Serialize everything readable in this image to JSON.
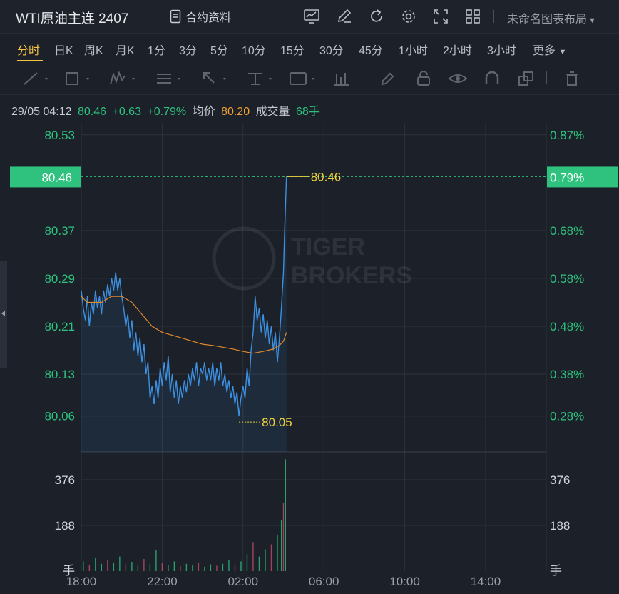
{
  "header": {
    "title": "WTI原油主连 2407",
    "info_label": "合约资料",
    "layout_label": "未命名图表布局",
    "icons": [
      "chart-indicator-icon",
      "edit-icon",
      "refresh-icon",
      "settings-icon",
      "fullscreen-icon",
      "grid-layout-icon"
    ]
  },
  "tabs": [
    "分时",
    "日K",
    "周K",
    "月K",
    "1分",
    "3分",
    "5分",
    "10分",
    "15分",
    "30分",
    "45分",
    "1小时",
    "2小时",
    "3小时",
    "更多"
  ],
  "active_tab": "分时",
  "infoline": {
    "datetime": "29/05 04:12",
    "price": "80.46",
    "change": "+0.63",
    "change_pct": "+0.79%",
    "avg_label": "均价",
    "avg_value": "80.20",
    "volume_label": "成交量",
    "volume_value": "68手"
  },
  "colors": {
    "up": "#2ec27e",
    "price_line": "#3d8fe0",
    "avg_line": "#e08a2a",
    "label_yellow": "#f0d23c",
    "background": "#1b2029",
    "grid": "#2c323c"
  },
  "chart_data": {
    "type": "line",
    "price_axis_labels": [
      "80.53",
      "80.46",
      "80.37",
      "80.29",
      "80.21",
      "80.13",
      "80.06"
    ],
    "pct_axis_labels": [
      "0.87%",
      "0.79%",
      "0.68%",
      "0.58%",
      "0.48%",
      "0.38%",
      "0.28%"
    ],
    "current_price_tag": "80.46",
    "current_pct_tag": "0.79%",
    "high_label": "80.46",
    "low_label": "80.05",
    "x_tick_labels": [
      "18:00",
      "22:00",
      "02:00",
      "06:00",
      "10:00",
      "14:00"
    ],
    "x_range_hours": [
      0,
      23
    ],
    "ylim": [
      80.0,
      80.55
    ],
    "volume_axis_labels": [
      "376",
      "188",
      "手"
    ],
    "volume_ylim": [
      0,
      470
    ],
    "watermark": "TIGER BROKERS",
    "price_series": [
      [
        0.0,
        80.27
      ],
      [
        0.1,
        80.24
      ],
      [
        0.2,
        80.22
      ],
      [
        0.3,
        80.26
      ],
      [
        0.4,
        80.21
      ],
      [
        0.5,
        80.25
      ],
      [
        0.6,
        80.23
      ],
      [
        0.7,
        80.27
      ],
      [
        0.8,
        80.24
      ],
      [
        0.9,
        80.26
      ],
      [
        1.0,
        80.23
      ],
      [
        1.1,
        80.27
      ],
      [
        1.2,
        80.25
      ],
      [
        1.3,
        80.28
      ],
      [
        1.4,
        80.26
      ],
      [
        1.5,
        80.29
      ],
      [
        1.6,
        80.27
      ],
      [
        1.7,
        80.3
      ],
      [
        1.8,
        80.27
      ],
      [
        1.9,
        80.29
      ],
      [
        2.0,
        80.26
      ],
      [
        2.1,
        80.24
      ],
      [
        2.2,
        80.21
      ],
      [
        2.3,
        80.23
      ],
      [
        2.4,
        80.19
      ],
      [
        2.5,
        80.22
      ],
      [
        2.6,
        80.17
      ],
      [
        2.7,
        80.2
      ],
      [
        2.8,
        80.16
      ],
      [
        2.9,
        80.19
      ],
      [
        3.0,
        80.15
      ],
      [
        3.1,
        80.18
      ],
      [
        3.2,
        80.13
      ],
      [
        3.3,
        80.15
      ],
      [
        3.4,
        80.09
      ],
      [
        3.5,
        80.11
      ],
      [
        3.6,
        80.08
      ],
      [
        3.7,
        80.12
      ],
      [
        3.8,
        80.09
      ],
      [
        3.9,
        80.14
      ],
      [
        4.0,
        80.11
      ],
      [
        4.1,
        80.15
      ],
      [
        4.2,
        80.12
      ],
      [
        4.3,
        80.16
      ],
      [
        4.4,
        80.1
      ],
      [
        4.5,
        80.13
      ],
      [
        4.6,
        80.09
      ],
      [
        4.7,
        80.12
      ],
      [
        4.8,
        80.08
      ],
      [
        4.9,
        80.11
      ],
      [
        5.0,
        80.09
      ],
      [
        5.1,
        80.12
      ],
      [
        5.2,
        80.1
      ],
      [
        5.3,
        80.13
      ],
      [
        5.4,
        80.11
      ],
      [
        5.5,
        80.14
      ],
      [
        5.6,
        80.12
      ],
      [
        5.7,
        80.15
      ],
      [
        5.8,
        80.11
      ],
      [
        5.9,
        80.14
      ],
      [
        6.0,
        80.13
      ],
      [
        6.1,
        80.15
      ],
      [
        6.2,
        80.12
      ],
      [
        6.3,
        80.14
      ],
      [
        6.4,
        80.12
      ],
      [
        6.5,
        80.15
      ],
      [
        6.6,
        80.11
      ],
      [
        6.7,
        80.14
      ],
      [
        6.8,
        80.12
      ],
      [
        6.9,
        80.15
      ],
      [
        7.0,
        80.11
      ],
      [
        7.1,
        80.13
      ],
      [
        7.2,
        80.1
      ],
      [
        7.3,
        80.12
      ],
      [
        7.4,
        80.09
      ],
      [
        7.5,
        80.11
      ],
      [
        7.6,
        80.08
      ],
      [
        7.7,
        80.1
      ],
      [
        7.8,
        80.06
      ],
      [
        7.9,
        80.09
      ],
      [
        8.0,
        80.11
      ],
      [
        8.1,
        80.09
      ],
      [
        8.2,
        80.14
      ],
      [
        8.3,
        80.11
      ],
      [
        8.4,
        80.17
      ],
      [
        8.5,
        80.2
      ],
      [
        8.6,
        80.26
      ],
      [
        8.7,
        80.22
      ],
      [
        8.8,
        80.24
      ],
      [
        8.9,
        80.2
      ],
      [
        9.0,
        80.23
      ],
      [
        9.1,
        80.19
      ],
      [
        9.2,
        80.22
      ],
      [
        9.3,
        80.18
      ],
      [
        9.4,
        80.21
      ],
      [
        9.5,
        80.17
      ],
      [
        9.6,
        80.2
      ],
      [
        9.7,
        80.15
      ],
      [
        9.8,
        80.19
      ],
      [
        9.9,
        80.24
      ],
      [
        10.0,
        80.3
      ],
      [
        10.05,
        80.36
      ],
      [
        10.1,
        80.41
      ],
      [
        10.15,
        80.46
      ]
    ],
    "avg_series": [
      [
        0.0,
        80.26
      ],
      [
        0.3,
        80.25
      ],
      [
        0.6,
        80.25
      ],
      [
        1.0,
        80.25
      ],
      [
        1.5,
        80.26
      ],
      [
        2.0,
        80.26
      ],
      [
        2.5,
        80.25
      ],
      [
        3.0,
        80.23
      ],
      [
        3.5,
        80.21
      ],
      [
        4.0,
        80.2
      ],
      [
        4.5,
        80.195
      ],
      [
        5.0,
        80.19
      ],
      [
        5.5,
        80.185
      ],
      [
        6.0,
        80.18
      ],
      [
        6.5,
        80.178
      ],
      [
        7.0,
        80.175
      ],
      [
        7.5,
        80.172
      ],
      [
        8.0,
        80.168
      ],
      [
        8.5,
        80.165
      ],
      [
        9.0,
        80.168
      ],
      [
        9.5,
        80.172
      ],
      [
        9.8,
        80.178
      ],
      [
        10.0,
        80.185
      ],
      [
        10.15,
        80.2
      ]
    ],
    "volume_series": [
      [
        0.1,
        40
      ],
      [
        0.4,
        25
      ],
      [
        0.7,
        55
      ],
      [
        1.0,
        30
      ],
      [
        1.3,
        45
      ],
      [
        1.6,
        35
      ],
      [
        1.9,
        60
      ],
      [
        2.2,
        28
      ],
      [
        2.5,
        38
      ],
      [
        2.8,
        22
      ],
      [
        3.1,
        50
      ],
      [
        3.4,
        30
      ],
      [
        3.7,
        85
      ],
      [
        4.0,
        35
      ],
      [
        4.3,
        25
      ],
      [
        4.6,
        40
      ],
      [
        4.9,
        20
      ],
      [
        5.2,
        30
      ],
      [
        5.5,
        25
      ],
      [
        5.8,
        35
      ],
      [
        6.1,
        18
      ],
      [
        6.4,
        28
      ],
      [
        6.7,
        22
      ],
      [
        7.0,
        30
      ],
      [
        7.3,
        45
      ],
      [
        7.6,
        26
      ],
      [
        7.9,
        40
      ],
      [
        8.2,
        70
      ],
      [
        8.5,
        120
      ],
      [
        8.8,
        60
      ],
      [
        9.1,
        90
      ],
      [
        9.4,
        110
      ],
      [
        9.7,
        150
      ],
      [
        9.9,
        210
      ],
      [
        10.0,
        280
      ],
      [
        10.1,
        460
      ]
    ]
  }
}
